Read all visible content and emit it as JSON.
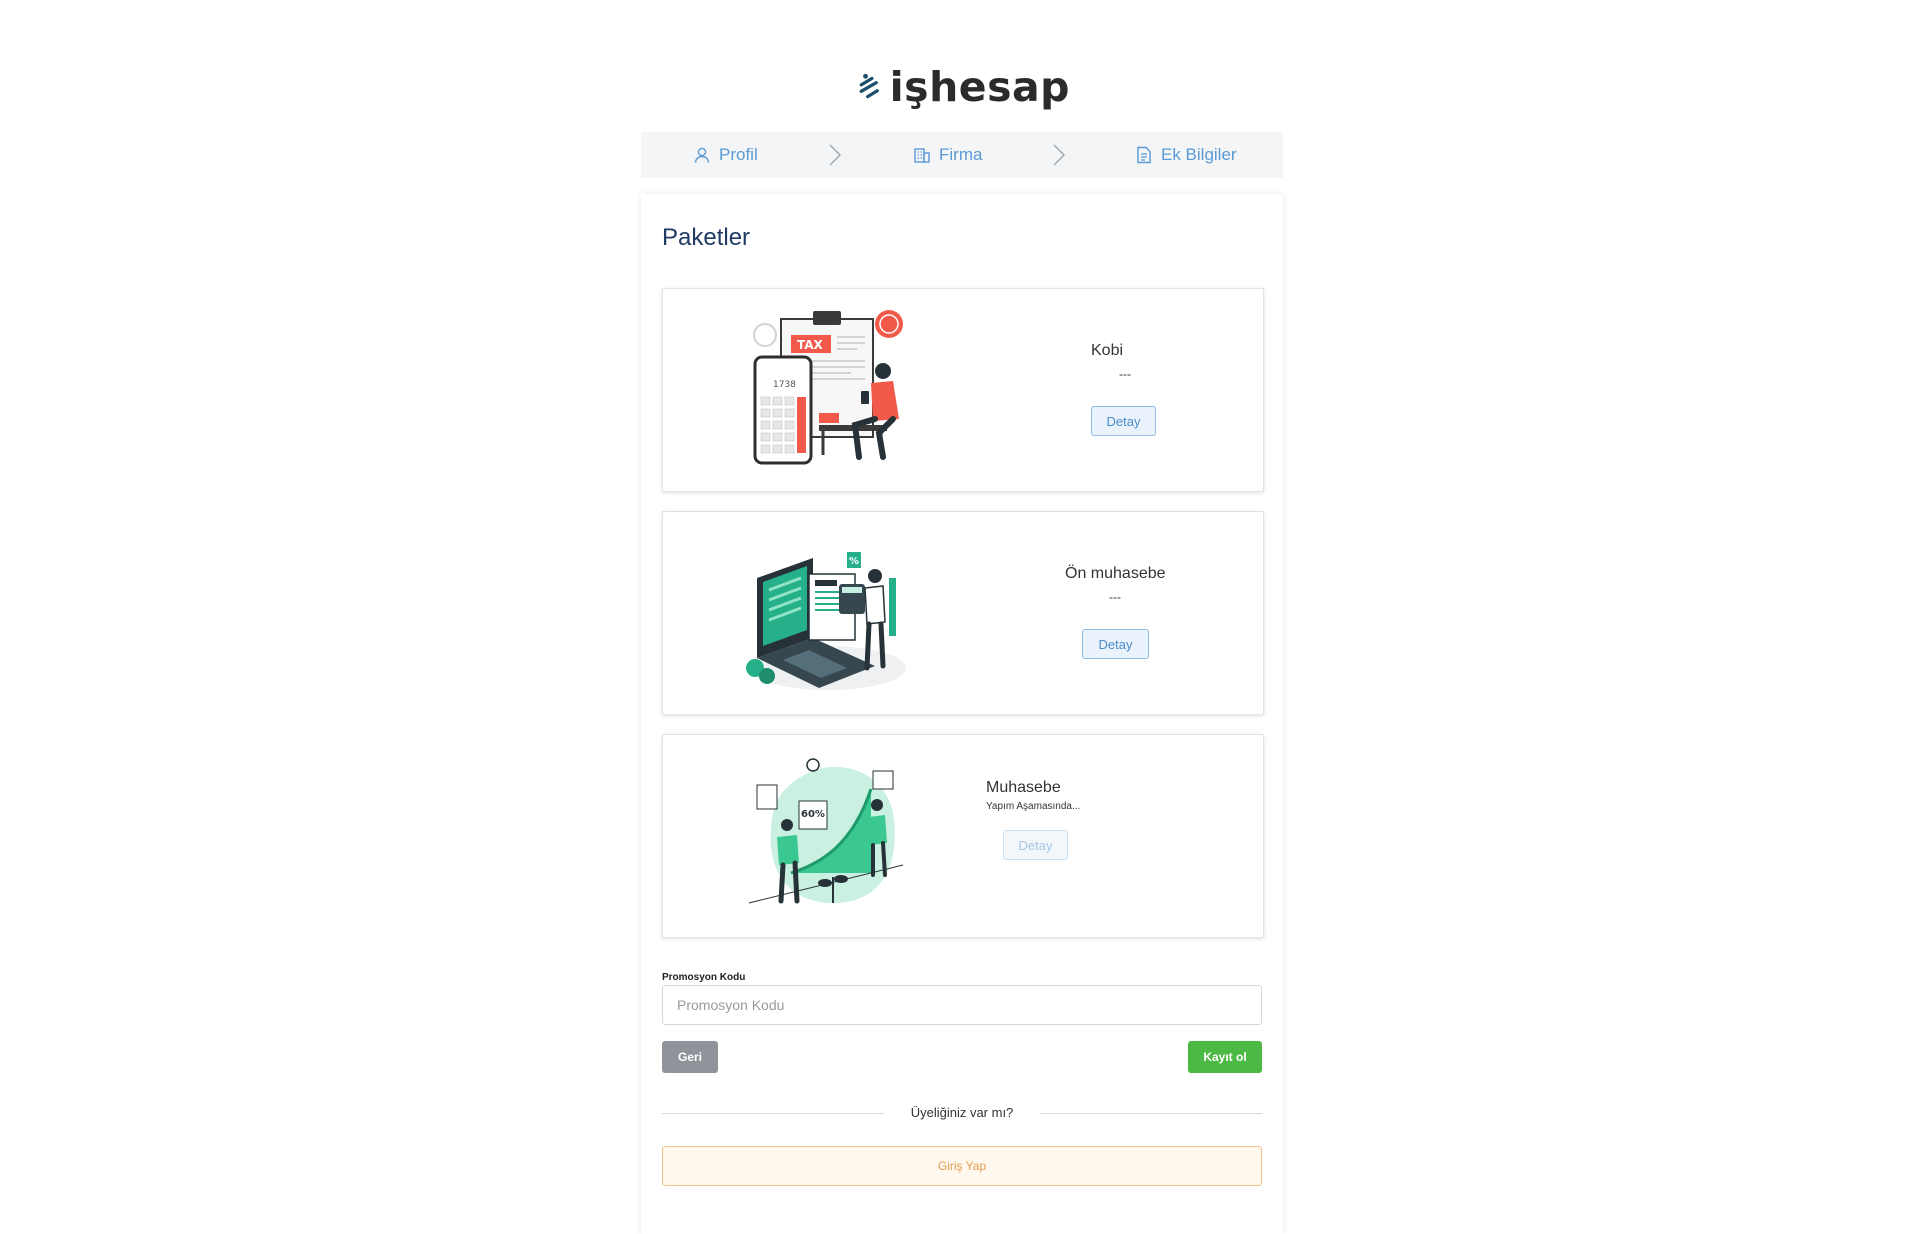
{
  "brand": {
    "name": "işhesap",
    "accent": "#5b9ad5"
  },
  "stepper": {
    "steps": [
      {
        "label": "Profil",
        "icon": "user-icon"
      },
      {
        "label": "Firma",
        "icon": "building-icon"
      },
      {
        "label": "Ek Bilgiler",
        "icon": "document-icon"
      }
    ]
  },
  "page": {
    "title": "Paketler"
  },
  "packages": [
    {
      "name": "Kobi",
      "subtitle": "---",
      "button": "Detay",
      "enabled": true,
      "illustration": "tax-calculator-illustration"
    },
    {
      "name": "Ön muhasebe",
      "subtitle": "---",
      "button": "Detay",
      "enabled": true,
      "illustration": "laptop-invoice-illustration"
    },
    {
      "name": "Muhasebe",
      "subtitle": "Yapım Aşamasında...",
      "button": "Detay",
      "enabled": false,
      "illustration": "growth-chart-illustration"
    }
  ],
  "promo": {
    "label": "Promosyon Kodu",
    "placeholder": "Promosyon Kodu",
    "value": ""
  },
  "actions": {
    "back": "Geri",
    "register": "Kayıt ol"
  },
  "login": {
    "prompt": "Üyeliğiniz var mı?",
    "button": "Giriş Yap"
  }
}
